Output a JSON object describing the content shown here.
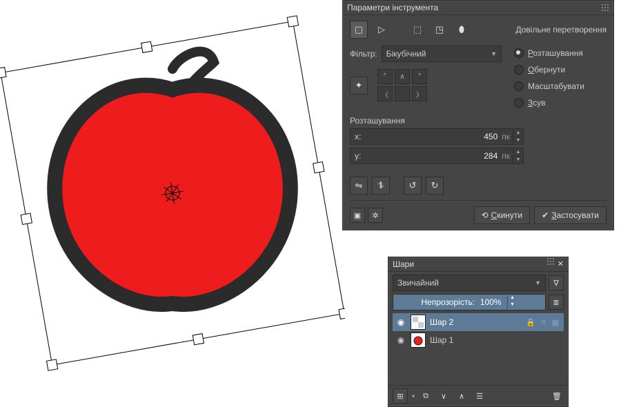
{
  "toolOptions": {
    "title": "Параметри інструмента",
    "modeLabel": "Довільне перетворення",
    "filterLabel": "Фільтр:",
    "filterValue": "Бікубічний",
    "radios": {
      "position": "Розташування",
      "rotate": "Обернути",
      "scale": "Масштабувати",
      "shear": "Зсув"
    },
    "positionSection": "Розташування",
    "x": {
      "label": "x:",
      "value": "450",
      "unit": "пк"
    },
    "y": {
      "label": "y:",
      "value": "284",
      "unit": "пк"
    },
    "resetLabel": "Скинути",
    "applyLabel": "Застосувати"
  },
  "layers": {
    "title": "Шари",
    "blendMode": "Звичайний",
    "opacityLabel": "Непрозорість:",
    "opacityValue": "100%",
    "layer2": "Шар 2",
    "layer1": "Шар 1"
  }
}
